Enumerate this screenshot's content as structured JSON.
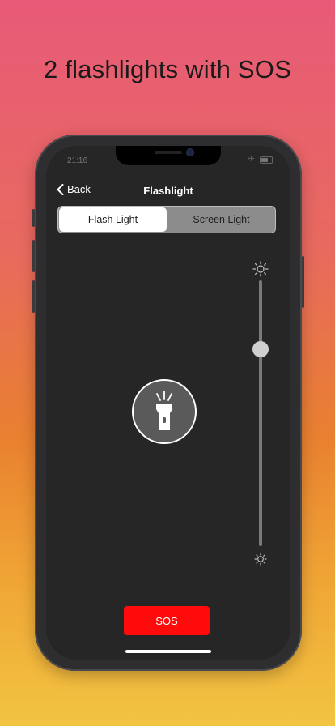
{
  "promo": {
    "headline": "2 flashlights with SOS"
  },
  "status_bar": {
    "time": "21:16",
    "airplane_icon": "airplane-icon",
    "battery_icon": "battery-icon"
  },
  "nav": {
    "back_label": "Back",
    "title": "Flashlight"
  },
  "segmented": {
    "options": [
      "Flash Light",
      "Screen Light"
    ],
    "selected": "Flash Light"
  },
  "brightness_slider": {
    "level": 0.74,
    "max_icon": "sun-bright-icon",
    "min_icon": "sun-dim-icon"
  },
  "torch": {
    "icon": "flashlight-icon"
  },
  "sos": {
    "label": "SOS",
    "color": "#ff0b0b"
  }
}
